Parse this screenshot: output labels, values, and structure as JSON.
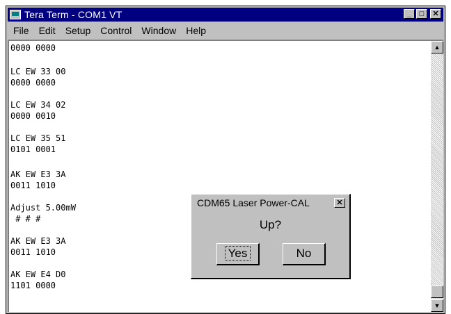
{
  "window": {
    "title": "Tera Term - COM1 VT",
    "buttons": {
      "minimize": "_",
      "maximize": "□",
      "close": "✕"
    }
  },
  "menu": [
    {
      "label": "File"
    },
    {
      "label": "Edit"
    },
    {
      "label": "Setup"
    },
    {
      "label": "Control"
    },
    {
      "label": "Window"
    },
    {
      "label": "Help"
    }
  ],
  "terminal": {
    "lines": [
      "0000 0000",
      "LC EW 33 00",
      "0000 0000",
      "LC EW 34 02",
      "0000 0010",
      "LC EW 35 51",
      "0101 0001",
      "AK EW E3 3A",
      "0011 1010",
      "Adjust 5.00mW",
      " # # #",
      "AK EW E3 3A",
      "0011 1010",
      "AK EW E4 D0",
      "1101 0000"
    ]
  },
  "scrollbar": {
    "up_arrow": "▲",
    "down_arrow": "▼"
  },
  "dialog": {
    "title": "CDM65 Laser Power-CAL",
    "close": "✕",
    "message": "Up?",
    "yes": "Yes",
    "no": "No"
  }
}
